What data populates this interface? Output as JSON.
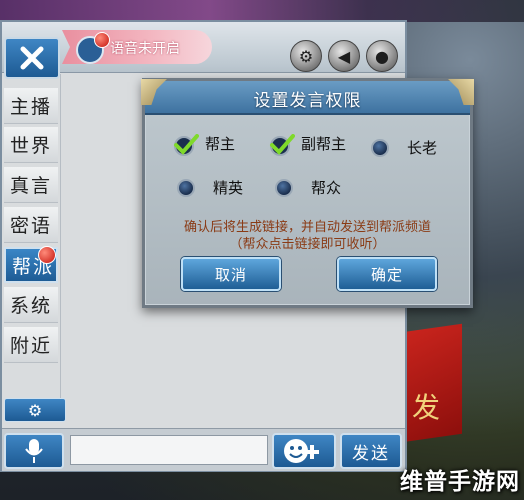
{
  "voice": {
    "status": "语音未开启"
  },
  "tabs": [
    {
      "label": "主播",
      "active": false
    },
    {
      "label": "世界",
      "active": false
    },
    {
      "label": "真言",
      "active": false
    },
    {
      "label": "密语",
      "active": false
    },
    {
      "label": "帮派",
      "active": true
    },
    {
      "label": "系统",
      "active": false
    },
    {
      "label": "附近",
      "active": false
    }
  ],
  "input": {
    "value": "",
    "placeholder": ""
  },
  "send_label": "发送",
  "dialog": {
    "title": "设置发言权限",
    "options": [
      {
        "label": "帮主",
        "checked": true
      },
      {
        "label": "副帮主",
        "checked": true
      },
      {
        "label": "长老",
        "checked": false
      },
      {
        "label": "精英",
        "checked": false
      },
      {
        "label": "帮众",
        "checked": false
      }
    ],
    "hint_line1": "确认后将生成链接，并自动发送到帮派频道",
    "hint_line2": "（帮众点击链接即可收听）",
    "cancel_label": "取消",
    "confirm_label": "确定"
  },
  "scene": {
    "red_char": "发"
  },
  "watermark": "维普手游网",
  "colors": {
    "accent_blue": "#1d5a93",
    "hint_text": "#8a3b15",
    "banner_pink": "#f3b7c1"
  }
}
